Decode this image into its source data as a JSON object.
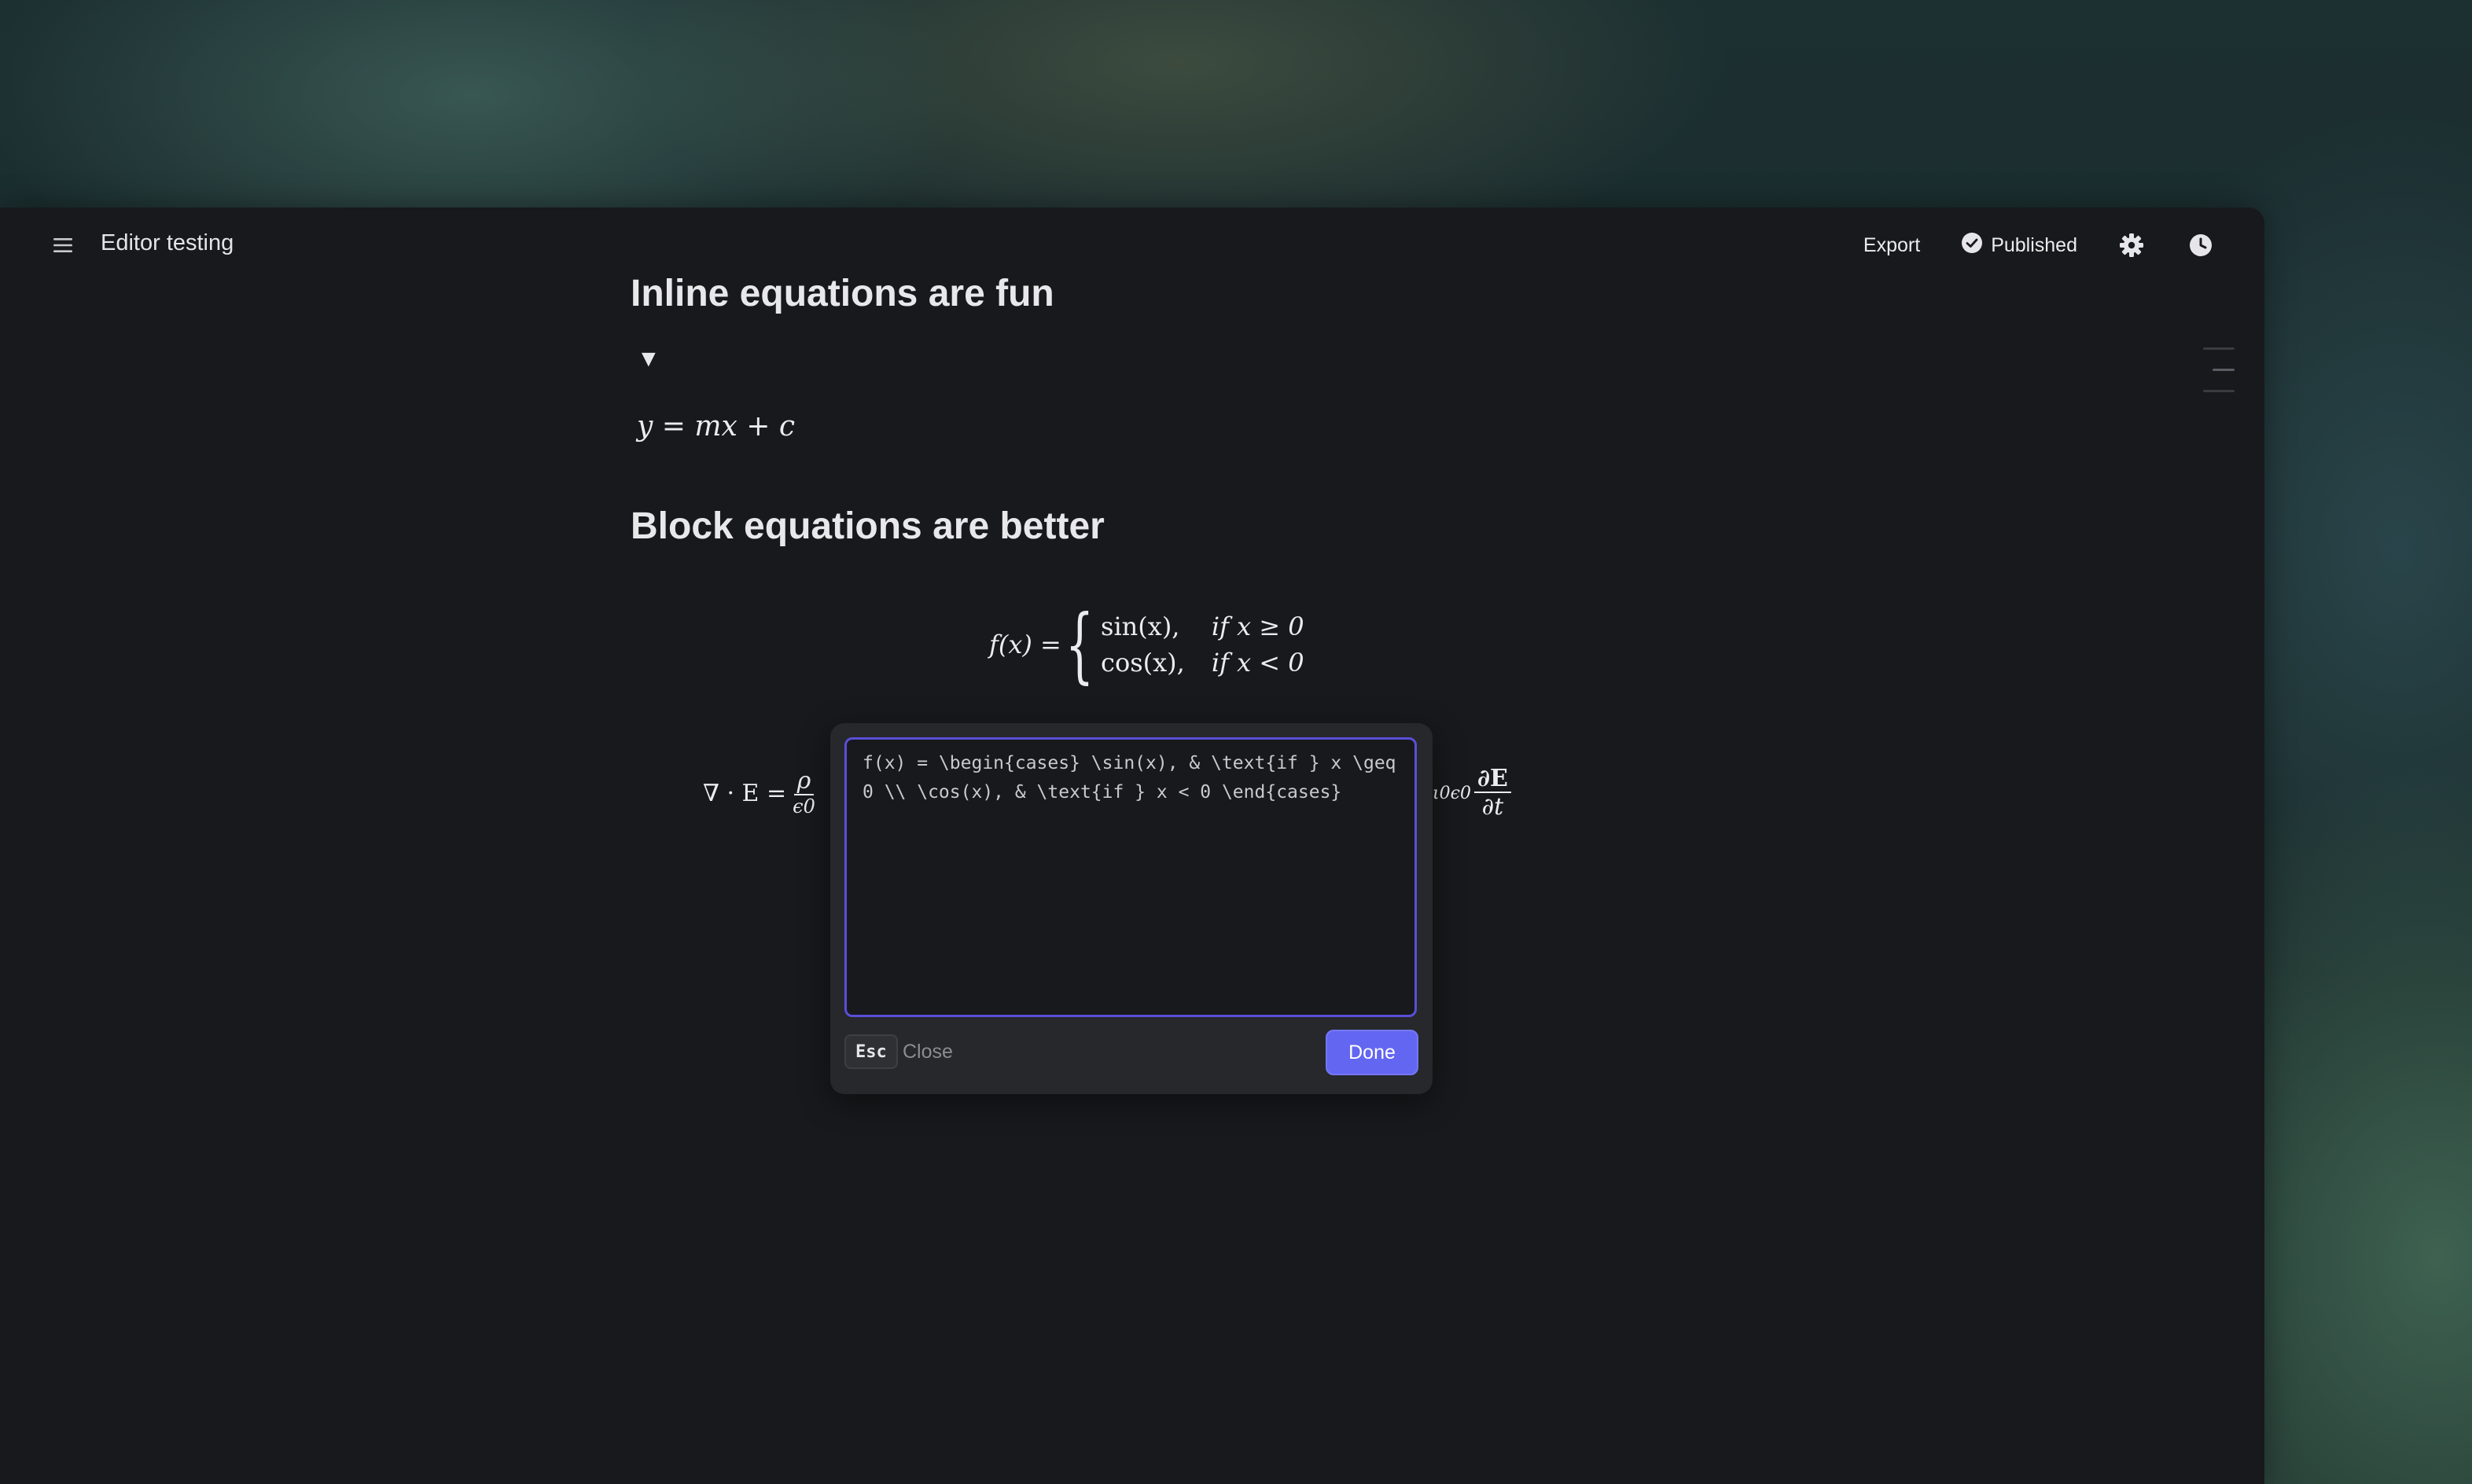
{
  "window": {
    "title": "Editor testing"
  },
  "toolbar": {
    "export_label": "Export",
    "status_label": "Published",
    "menu_icon": "hamburger-menu-icon",
    "status_icon": "check-circle-icon",
    "settings_icon": "gear-icon",
    "history_icon": "clock-icon"
  },
  "document": {
    "heading_inline": "Inline equations are fun",
    "toggle_glyph": "▼",
    "inline_equation": "y = mx + c",
    "heading_block": "Block equations are better",
    "block_equation_1": {
      "lhs": "f(x) =",
      "case1_expr": "sin(x),",
      "case1_cond": "if x ≥ 0",
      "case2_expr": "cos(x),",
      "case2_cond": "if x < 0"
    },
    "block_equation_2": {
      "lhs": "∇ · E =",
      "rho": "ρ",
      "eps0": "ϵ0",
      "right_fragment": "ι0ϵ0",
      "dE": "∂E",
      "dt": "∂t"
    }
  },
  "equation_popover": {
    "source": "f(x) = \\begin{cases} \\sin(x), & \\text{if } x \\geq 0 \\\\ \\cos(x), & \\text{if } x < 0 \\end{cases}",
    "esc_key": "Esc",
    "close_label": "Close",
    "done_label": "Done"
  },
  "colors": {
    "accent": "#6366f1",
    "editor_border": "#5a4fd8",
    "background": "#18191c"
  }
}
